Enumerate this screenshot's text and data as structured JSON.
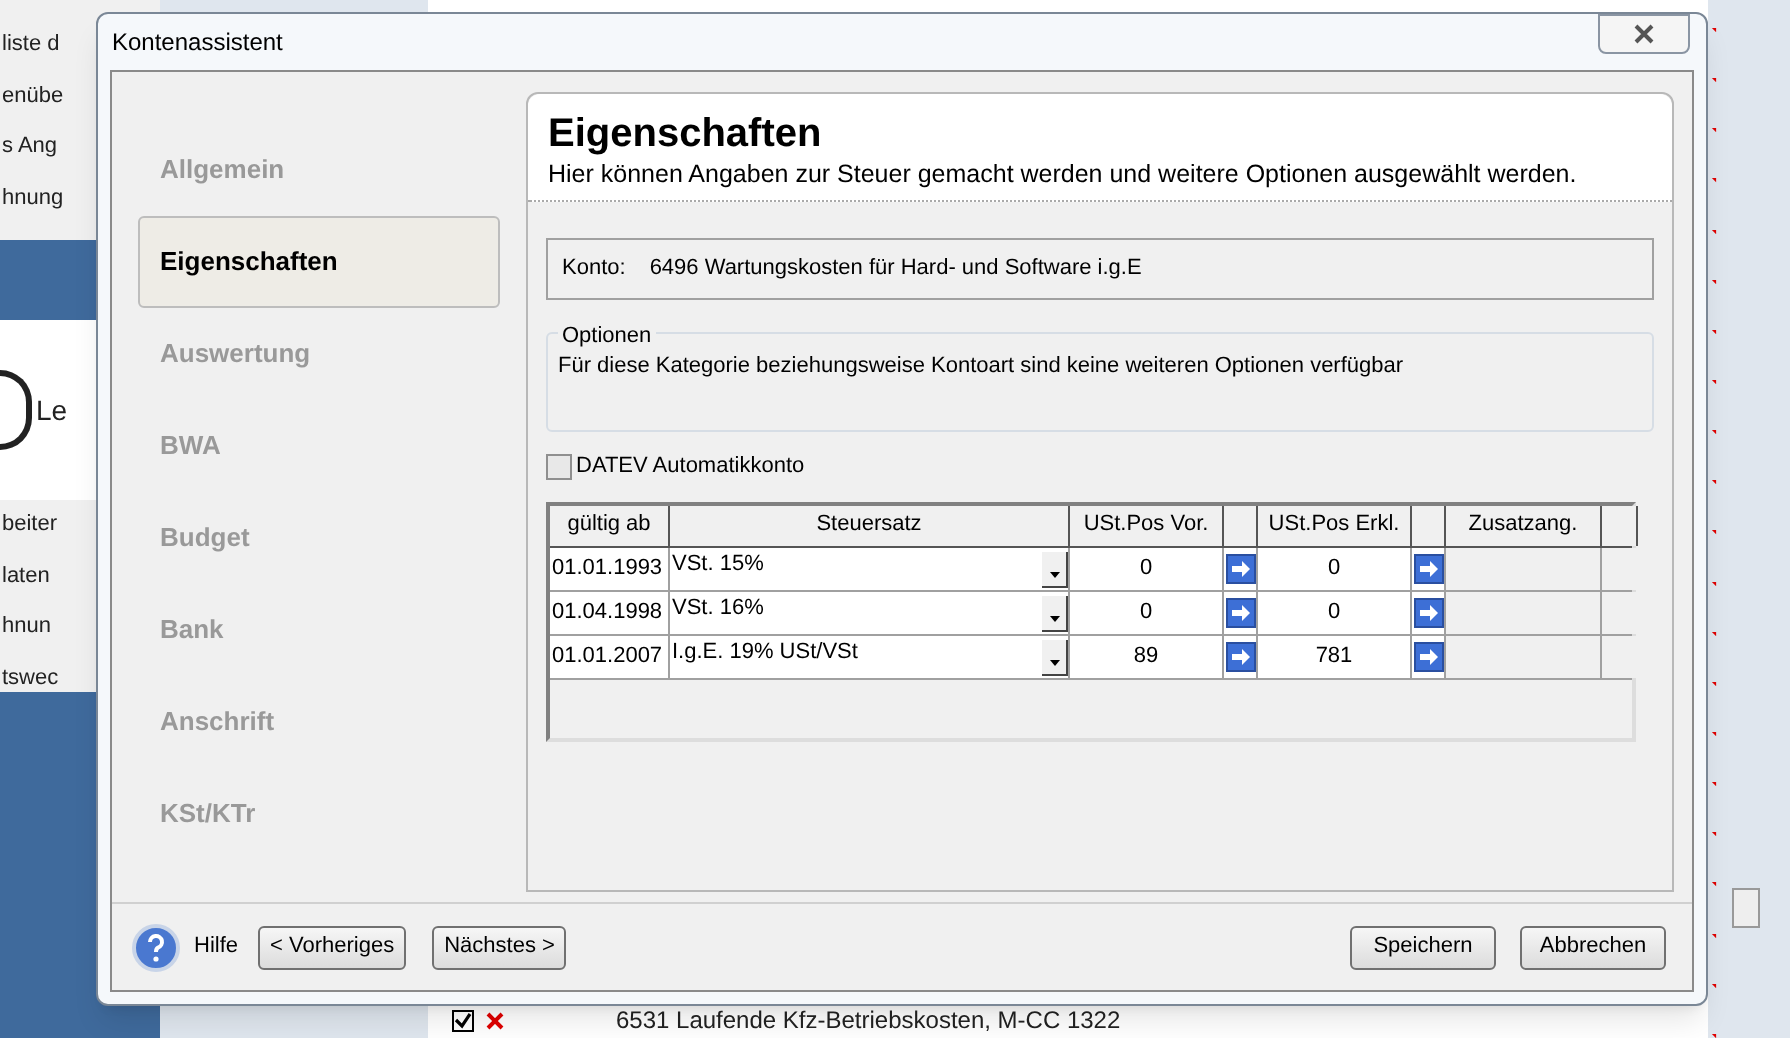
{
  "background_app": {
    "left_items": [
      "liste d",
      "enübe",
      "s Ang",
      "hnung"
    ],
    "left_card_text": "Le",
    "left_items_lower": [
      "beiter",
      "laten",
      "hnun",
      "tswec"
    ],
    "bottom_row": "6531 Laufende Kfz-Betriebskosten, M-CC 1322",
    "bottom_row_checked": true
  },
  "window": {
    "title": "Kontenassistent"
  },
  "nav": [
    {
      "label": "Allgemein",
      "selected": false
    },
    {
      "label": "Eigenschaften",
      "selected": true
    },
    {
      "label": "Auswertung",
      "selected": false
    },
    {
      "label": "BWA",
      "selected": false
    },
    {
      "label": "Budget",
      "selected": false
    },
    {
      "label": "Bank",
      "selected": false
    },
    {
      "label": "Anschrift",
      "selected": false
    },
    {
      "label": "KSt/KTr",
      "selected": false
    }
  ],
  "header": {
    "title": "Eigenschaften",
    "subtitle": "Hier können Angaben zur Steuer gemacht werden und weitere Optionen ausgewählt werden."
  },
  "konto": {
    "label": "Konto:",
    "value": "6496 Wartungskosten für Hard- und Software i.g.E"
  },
  "options": {
    "legend": "Optionen",
    "text": "Für diese Kategorie beziehungsweise Kontoart sind keine weiteren Optionen verfügbar"
  },
  "datev_checkbox": {
    "label": "DATEV Automatikkonto",
    "checked": false
  },
  "table": {
    "columns": [
      "gültig ab",
      "Steuersatz",
      "USt.Pos Vor.",
      "USt.Pos Erkl.",
      "Zusatzang."
    ],
    "rows": [
      {
        "date": "01.01.1993",
        "rate": "VSt. 15%",
        "vor": "0",
        "erkl": "0"
      },
      {
        "date": "01.04.1998",
        "rate": "VSt. 16%",
        "vor": "0",
        "erkl": "0"
      },
      {
        "date": "01.01.2007",
        "rate": "I.g.E. 19% USt/VSt",
        "vor": "89",
        "erkl": "781"
      }
    ]
  },
  "footer": {
    "help": "Hilfe",
    "nav_buttons": [
      "< Vorheriges",
      "Nächstes >"
    ],
    "action_buttons": [
      "Speichern",
      "Abbrechen"
    ]
  }
}
